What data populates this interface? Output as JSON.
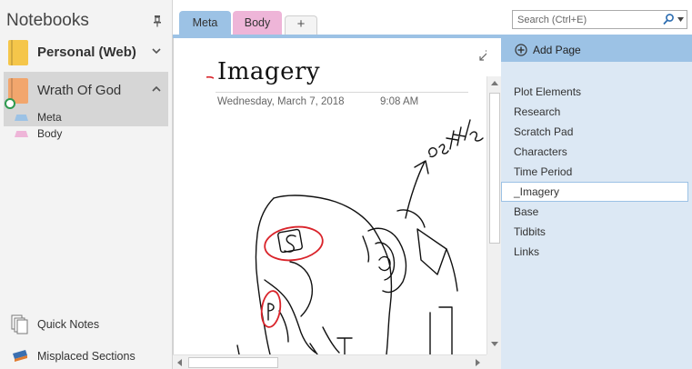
{
  "notebook_pane": {
    "title": "Notebooks",
    "notebooks": [
      {
        "name": "Personal (Web)",
        "color": "#f5c64a",
        "expanded": false
      },
      {
        "name": "Wrath Of God",
        "color": "#f2a66d",
        "expanded": true
      }
    ],
    "sections": [
      {
        "name": "Meta",
        "color": "#9cc2e5"
      },
      {
        "name": "Body",
        "color": "#eeb5d8"
      }
    ],
    "quick_notes": "Quick Notes",
    "misplaced_sections": "Misplaced Sections"
  },
  "tabs": [
    {
      "label": "Meta",
      "color": "#9cc2e5",
      "active": true
    },
    {
      "label": "Body",
      "color": "#eeb5d8",
      "active": false
    }
  ],
  "add_tab_label": "+",
  "page": {
    "title": "Imagery",
    "date": "Wednesday, March 7, 2018",
    "time": "9:08 AM",
    "ink_text": "settle"
  },
  "search": {
    "placeholder": "Search (Ctrl+E)"
  },
  "page_list": {
    "add_page_label": "Add Page",
    "pages": [
      {
        "label": "Plot Elements",
        "selected": false
      },
      {
        "label": "Research",
        "selected": false
      },
      {
        "label": "Scratch Pad",
        "selected": false
      },
      {
        "label": "Characters",
        "selected": false
      },
      {
        "label": "Time Period",
        "selected": false
      },
      {
        "label": "_Imagery",
        "selected": true
      },
      {
        "label": "Base",
        "selected": false
      },
      {
        "label": "Tidbits",
        "selected": false
      },
      {
        "label": "Links",
        "selected": false
      }
    ]
  },
  "colors": {
    "accent_blue": "#9cc2e5",
    "page_list_bg": "#dce8f4",
    "ink_red": "#d9232a",
    "ink_black": "#111111"
  }
}
